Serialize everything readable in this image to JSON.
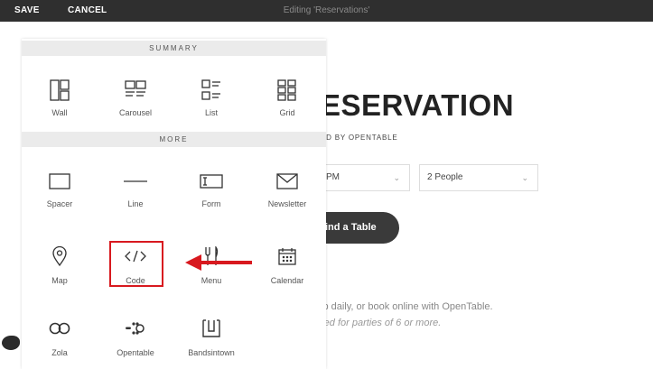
{
  "topbar": {
    "save_label": "SAVE",
    "cancel_label": "CANCEL",
    "title": "Editing 'Reservations'"
  },
  "background": {
    "title_partial": "ESERVATION",
    "powered_partial": "ED BY OPENTABLE",
    "time_partial": "PM",
    "people": "2 People",
    "find_partial": "ind a Table",
    "text1_partial": "ip daily, or book online with OpenTable.",
    "text2_partial": "red for parties of 6 or more."
  },
  "panel": {
    "summary_header": "SUMMARY",
    "more_header": "MORE",
    "summary_items": [
      {
        "label": "Wall",
        "icon": "wall-icon"
      },
      {
        "label": "Carousel",
        "icon": "carousel-icon"
      },
      {
        "label": "List",
        "icon": "list-icon"
      },
      {
        "label": "Grid",
        "icon": "grid-icon"
      }
    ],
    "more_items": [
      {
        "label": "Spacer",
        "icon": "spacer-icon"
      },
      {
        "label": "Line",
        "icon": "line-icon"
      },
      {
        "label": "Form",
        "icon": "form-icon"
      },
      {
        "label": "Newsletter",
        "icon": "newsletter-icon"
      },
      {
        "label": "Map",
        "icon": "map-pin-icon"
      },
      {
        "label": "Code",
        "icon": "code-icon"
      },
      {
        "label": "Menu",
        "icon": "fork-knife-icon"
      },
      {
        "label": "Calendar",
        "icon": "calendar-icon"
      },
      {
        "label": "Zola",
        "icon": "zola-icon"
      },
      {
        "label": "Opentable",
        "icon": "opentable-icon"
      },
      {
        "label": "Bandsintown",
        "icon": "bandsintown-icon"
      }
    ]
  },
  "colors": {
    "topbar_bg": "#2f2f2f",
    "highlight": "#d8191f"
  }
}
